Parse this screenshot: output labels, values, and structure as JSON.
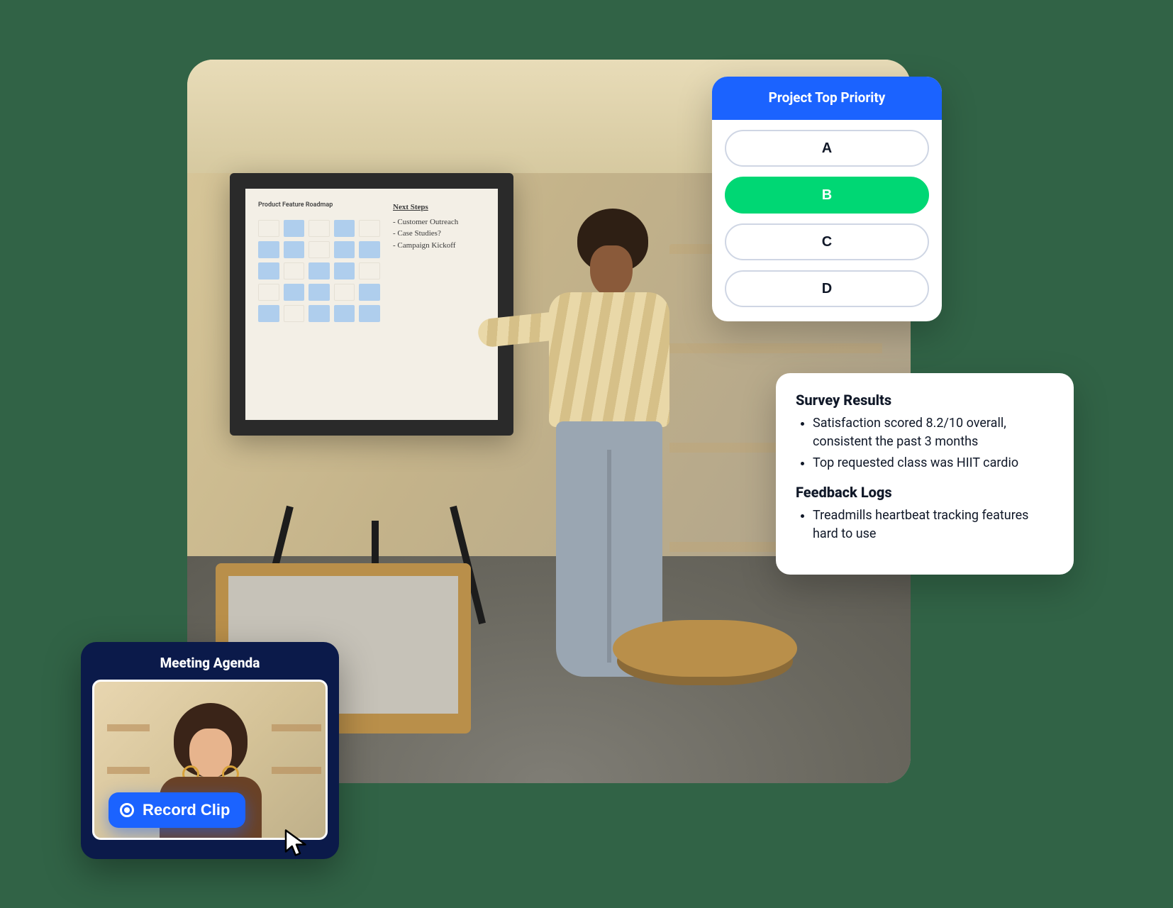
{
  "poll": {
    "title": "Project Top Priority",
    "options": [
      "A",
      "B",
      "C",
      "D"
    ],
    "selected_index": 1
  },
  "results": {
    "sections": [
      {
        "heading": "Survey Results",
        "items": [
          "Satisfaction scored 8.2/10 overall, consistent the past 3 months",
          "Top requested class was HIIT cardio"
        ]
      },
      {
        "heading": "Feedback Logs",
        "items": [
          "Treadmills heartbeat tracking features hard to use"
        ]
      }
    ]
  },
  "agenda": {
    "title": "Meeting Agenda",
    "record_label": "Record Clip"
  },
  "whiteboard": {
    "chart_title": "Product Feature Roadmap",
    "handwriting_title": "Next Steps",
    "handwriting_items": [
      "Customer Outreach",
      "Case Studies?",
      "Campaign Kickoff"
    ]
  }
}
